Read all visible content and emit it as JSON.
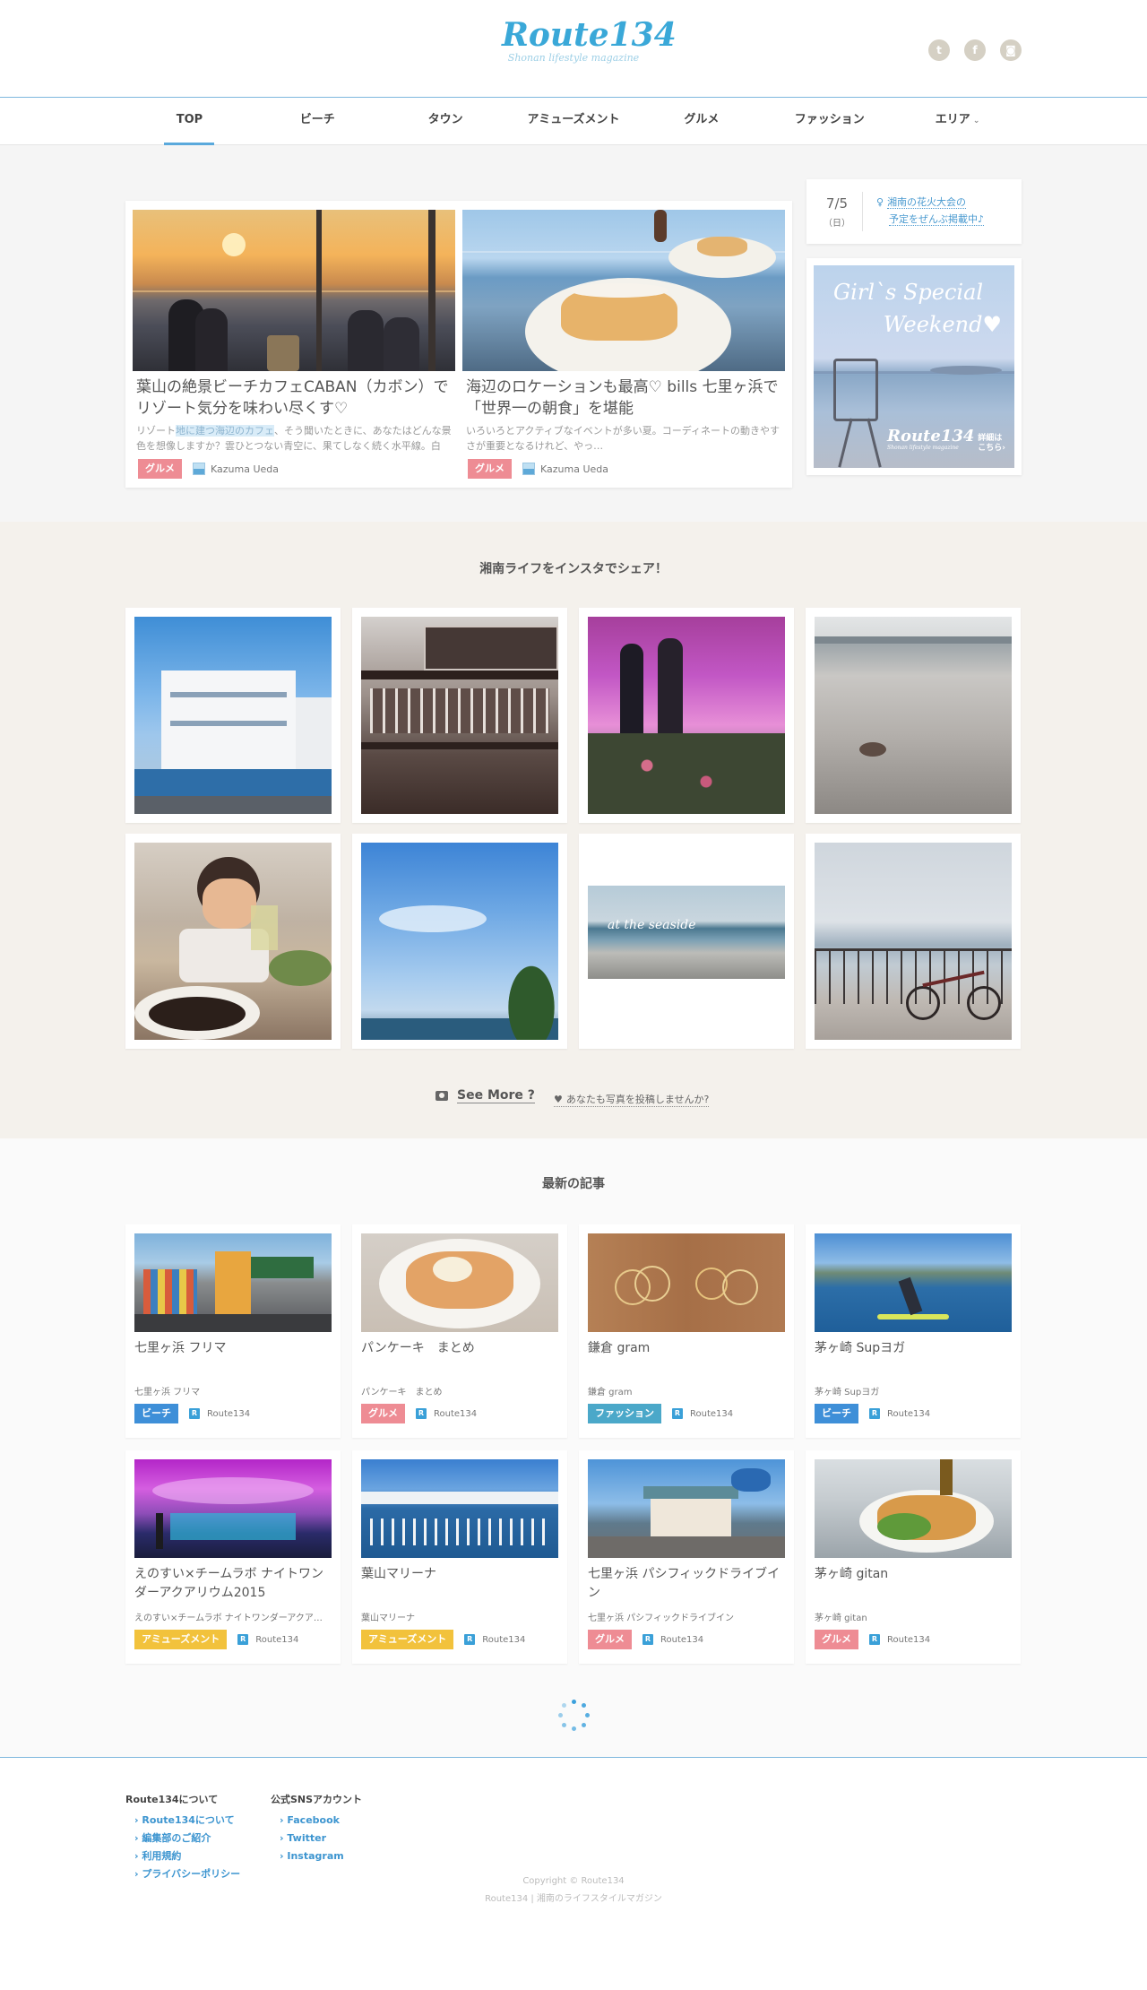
{
  "header": {
    "logo_title": "Route134",
    "logo_subtitle": "Shonan lifestyle magazine",
    "sns_icons": [
      "twitter-icon",
      "facebook-icon",
      "instagram-icon"
    ]
  },
  "nav": {
    "items": [
      "TOP",
      "ビーチ",
      "タウン",
      "アミューズメント",
      "グルメ",
      "ファッション",
      "エリア"
    ],
    "active": "TOP"
  },
  "feature": {
    "articles": [
      {
        "title": "葉山の絶景ビーチカフェCABAN（カボン）でリゾート気分を味わい尽くす♡",
        "excerpt_pre": "リゾート",
        "excerpt_hl": "地に建つ海辺のカフェ",
        "excerpt_post": "、そう聞いたときに、あなたはどんな景色を想像しますか？雲ひとつない青空に、果てしなく続く水平線。白を…",
        "category": "グルメ",
        "author": "Kazuma Ueda"
      },
      {
        "title": "海辺のロケーションも最高♡ bills 七里ヶ浜で「世界一の朝食」を堪能",
        "excerpt": "いろいろとアクティブなイベントが多い夏。コーディネートの動きやすさが重要となるけれど、やっ…",
        "category": "グルメ",
        "author": "Kazuma Ueda"
      }
    ]
  },
  "sidebar": {
    "date": "7/5",
    "weekday": "（日）",
    "news_line1": "湘南の花火大会の",
    "news_line2": "予定をぜんぶ掲載中♪",
    "banner_line1": "Girl`s Special",
    "banner_line2": "Weekend♥",
    "banner_logo": "Route134",
    "banner_logo_sub": "Shonan lifestyle magazine",
    "banner_more_1": "詳細は",
    "banner_more_2": "こちら›"
  },
  "instagram": {
    "title": "湘南ライフをインスタでシェア！",
    "see_more": "See More ?",
    "post_link": "あなたも写真を投稿しませんか?"
  },
  "latest": {
    "title": "最新の記事",
    "articles": [
      {
        "title": "七里ヶ浜 フリマ",
        "sub": "七里ヶ浜 フリマ",
        "category": "ビーチ",
        "author": "Route134"
      },
      {
        "title": "パンケーキ　まとめ",
        "sub": "パンケーキ　まとめ",
        "category": "グルメ",
        "author": "Route134"
      },
      {
        "title": "鎌倉 gram",
        "sub": "鎌倉 gram",
        "category": "ファッション",
        "author": "Route134"
      },
      {
        "title": "茅ヶ崎 Supヨガ",
        "sub": "茅ヶ崎 Supヨガ",
        "category": "ビーチ",
        "author": "Route134"
      },
      {
        "title": "えのすい×チームラボ ナイトワンダーアクアリウム2015",
        "sub": "えのすい×チームラボ ナイトワンダーアクア…",
        "category": "アミューズメント",
        "author": "Route134"
      },
      {
        "title": "葉山マリーナ",
        "sub": "葉山マリーナ",
        "category": "アミューズメント",
        "author": "Route134"
      },
      {
        "title": "七里ヶ浜 パシフィックドライブイン",
        "sub": "七里ヶ浜 パシフィックドライブイン",
        "category": "グルメ",
        "author": "Route134"
      },
      {
        "title": "茅ヶ崎 gitan",
        "sub": "茅ヶ崎 gitan",
        "category": "グルメ",
        "author": "Route134"
      }
    ]
  },
  "footer": {
    "col1_title": "Route134について",
    "col1_links": [
      "Route134について",
      "編集部のご紹介",
      "利用規約",
      "プライバシーポリシー"
    ],
    "col2_title": "公式SNSアカウント",
    "col2_links": [
      "Facebook",
      "Twitter",
      "Instagram"
    ],
    "copyright": "Copyright © Route134",
    "tagline": "Route134 | 湘南のライフスタイルマガジン"
  },
  "colors": {
    "accent": "#3aa8d8",
    "gourmet": "#ee8c94",
    "beach": "#3e8fd8",
    "fashion": "#4ba8c9",
    "amusement": "#f2c23c"
  }
}
